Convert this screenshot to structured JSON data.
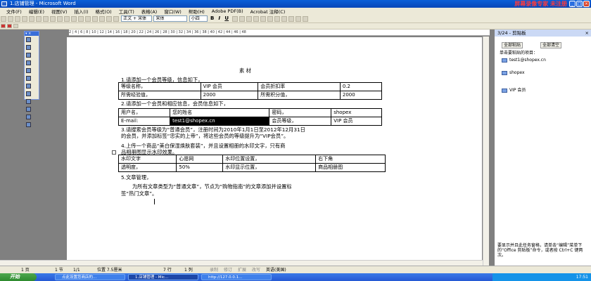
{
  "window": {
    "title": "1.店铺管理 - Microsoft Word",
    "watermark": "屏幕录像专家 未注册"
  },
  "menu": [
    "文件(F)",
    "编辑(E)",
    "视图(V)",
    "插入(I)",
    "格式(O)",
    "工具(T)",
    "表格(A)",
    "窗口(W)",
    "帮助(H)",
    "Adobe PDF(B)",
    "Acrobat 注释(C)"
  ],
  "toolbar": {
    "style": "正文 + 宋体",
    "font": "宋体",
    "size": "小四",
    "bold": "B",
    "italic": "I",
    "underline": "U"
  },
  "ruler_text": "2 | 4 | 6 | 8 | 10 | 12 | 14 | 16 | 18 | 20 | 22 | 24 | 26 | 28 | 30 | 32 | 34 | 36 | 38 | 40 | 42 | 44 | 46 | 48",
  "doc": {
    "title": "素 材",
    "p1": "1.请添加一个会员等级，信息如下，",
    "t1": [
      [
        "等级名称，",
        "VIP 会员",
        "会员折扣率",
        "0.2"
      ],
      [
        "所需经验值，",
        "2000",
        "所需积分值，",
        "2000"
      ]
    ],
    "p2": "2.请添加一个会员和相应信息，会员信息如下，",
    "t2": [
      [
        "用户名，",
        "您的姓名",
        "密码，",
        "shopex"
      ],
      [
        "E-mail:",
        "test1@shopex.cn",
        "会员等级，",
        "VIP 会员"
      ]
    ],
    "p3a": "3.请搜索会员等级为“普通会员”，注册时间为2010年1月1日至2012年12月31日",
    "p3b": "的会员，并添加标签“忠实的上帝”，将这些会员的等级提升为“VIP会员”。",
    "p4a": "4.上传一个商品“美白保湿焕肤套装”，并且设置相册的水印文字，只有商",
    "p4b": "品相册图显示水印效果。",
    "t3": [
      [
        "水印文字",
        "心愿网",
        "水印位置设置，",
        "右下角"
      ],
      [
        "透明度，",
        "50%",
        "水印显示位置，",
        "商品相册图"
      ]
    ],
    "p5": "5.文章管理，",
    "p5a": "为所有文章类型为“普通文章”，节点为“购物指南”的文章添加并设置标",
    "p5b": "签“热门文章”。"
  },
  "taskpane": {
    "title": "3/24 - 剪贴板",
    "paste_all": "全部粘贴",
    "clear_all": "全部清空",
    "hint": "单击要粘贴的项目：",
    "items": [
      "test1@shopex.cn",
      "shopex",
      "VIP 会员"
    ],
    "footer": "要显示并且此任务窗格，请单击“编辑”菜单下的“Office 剪贴板”命令，或者按 Ctrl+C 键两次。"
  },
  "status": {
    "page": "1 页",
    "section": "1 节",
    "pages": "1/1",
    "position": "位置 7.5厘米",
    "line": "7 行",
    "col": "1 列",
    "rec": "录制",
    "rev": "修订",
    "ext": "扩展",
    "ovr": "改写",
    "lang": "英语(美国)"
  },
  "taskbar": {
    "start": "开始",
    "tasks": [
      "点此设置您商店的...",
      "1.店铺管理 - Mic...",
      "http://127.0.0.1..."
    ],
    "time": "17:51"
  }
}
